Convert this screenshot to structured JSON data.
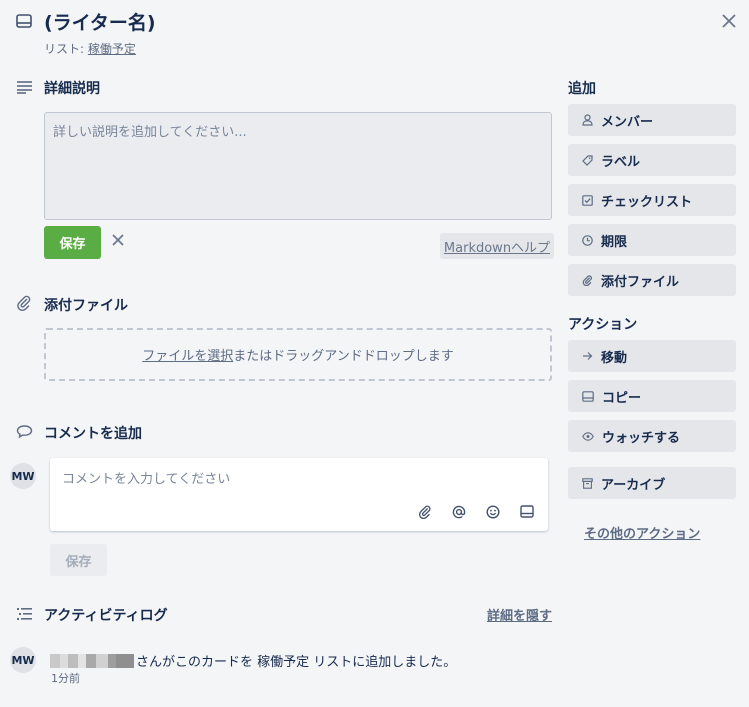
{
  "header": {
    "title": "(ライター名)",
    "list_prefix": "リスト: ",
    "list_name": "稼働予定"
  },
  "description": {
    "title": "詳細説明",
    "placeholder": "詳しい説明を追加してください...",
    "save_label": "保存",
    "markdown_help": "Markdownヘルプ"
  },
  "attachments": {
    "title": "添付ファイル",
    "select_link": "ファイルを選択",
    "drop_text": "またはドラッグアンドドロップします"
  },
  "comment": {
    "title": "コメントを追加",
    "avatar_initials": "MW",
    "placeholder": "コメントを入力してください",
    "save_label": "保存"
  },
  "activity": {
    "title": "アクティビティログ",
    "hide_details": "詳細を隠す",
    "avatar_initials": "MW",
    "entry_text": "さんがこのカードを 稼働予定 リストに追加しました。",
    "entry_time": "1分前"
  },
  "sidebar": {
    "add_title": "追加",
    "add_buttons": [
      {
        "label": "メンバー",
        "icon": "person-icon"
      },
      {
        "label": "ラベル",
        "icon": "tag-icon"
      },
      {
        "label": "チェックリスト",
        "icon": "checkbox-icon"
      },
      {
        "label": "期限",
        "icon": "clock-icon"
      },
      {
        "label": "添付ファイル",
        "icon": "paperclip-icon"
      }
    ],
    "actions_title": "アクション",
    "action_buttons": [
      {
        "label": "移動",
        "icon": "arrow-right-icon"
      },
      {
        "label": "コピー",
        "icon": "card-icon"
      },
      {
        "label": "ウォッチする",
        "icon": "eye-icon"
      },
      {
        "label": "アーカイブ",
        "icon": "archive-icon"
      }
    ],
    "more_actions": "その他のアクション"
  },
  "colors": {
    "save_green": "#5aac44",
    "background": "#f4f5f7",
    "button_gray": "#e4e6ea"
  }
}
